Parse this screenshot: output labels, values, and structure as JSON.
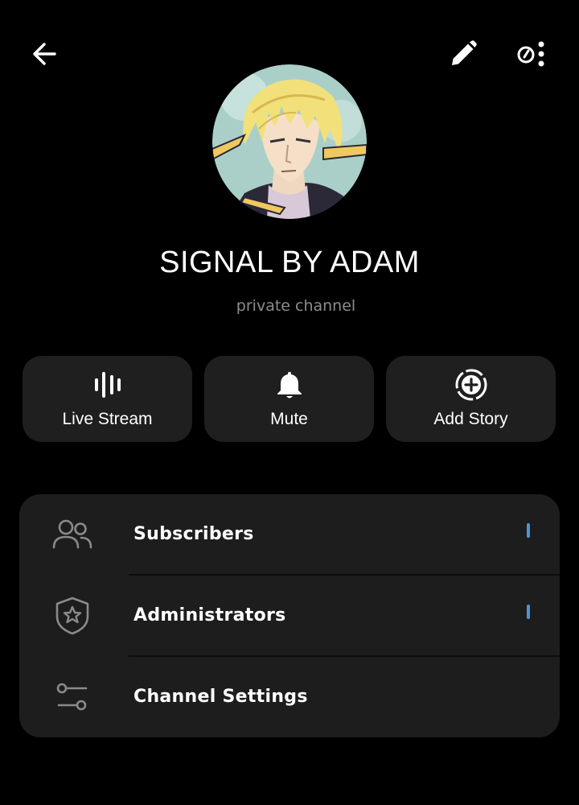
{
  "header": {
    "back_icon": "arrow-left-icon",
    "edit_icon": "pencil-icon",
    "more_icon": "more-options-icon"
  },
  "channel": {
    "name": "SIGNAL BY ADAM",
    "type_label": "private channel",
    "avatar_icon": "anime-character-avatar"
  },
  "actions": [
    {
      "label": "Live Stream",
      "icon": "live-stream-icon"
    },
    {
      "label": "Mute",
      "icon": "bell-icon"
    },
    {
      "label": "Add Story",
      "icon": "add-story-icon"
    }
  ],
  "menu": {
    "items": [
      {
        "label": "Subscribers",
        "icon": "people-icon",
        "count": "1"
      },
      {
        "label": "Administrators",
        "icon": "shield-star-icon",
        "count": "1"
      },
      {
        "label": "Channel Settings",
        "icon": "sliders-icon"
      }
    ]
  },
  "colors": {
    "background": "#000000",
    "card": "#1f1f1f",
    "accent": "#4f93d8",
    "secondary_text": "#8d8d8d"
  }
}
